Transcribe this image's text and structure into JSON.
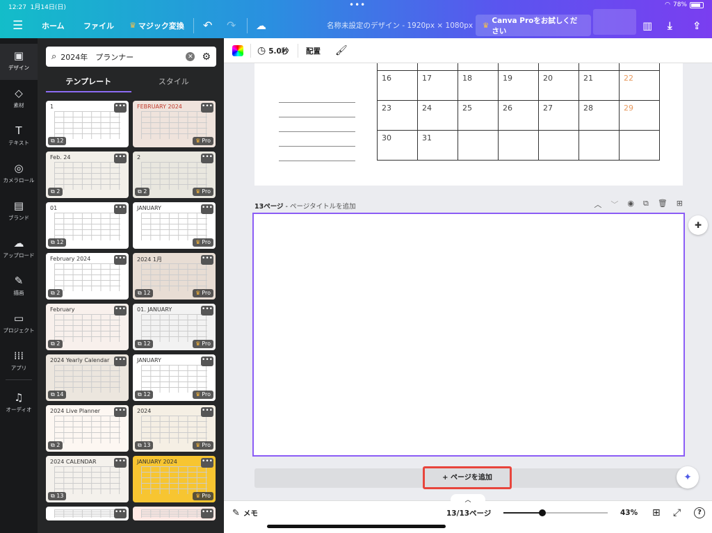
{
  "status": {
    "time": "12:27",
    "date": "1月14日(日)",
    "battery": "78%",
    "dots": "•••"
  },
  "topbar": {
    "menu_icon": "hamburger-icon",
    "home": "ホーム",
    "file": "ファイル",
    "magic": "マジック変換",
    "doc_title": "名称未設定のデザイン - 1920px × 1080px",
    "pro_button": "Canva Proをお試しください",
    "accent": "#7a3ef0"
  },
  "rail": [
    {
      "label": "デザイン",
      "icon": "design-icon",
      "glyph": "▣"
    },
    {
      "label": "素材",
      "icon": "elements-icon",
      "glyph": "◇"
    },
    {
      "label": "テキスト",
      "icon": "text-icon",
      "glyph": "T"
    },
    {
      "label": "カメラロール",
      "icon": "camera-icon",
      "glyph": "◎"
    },
    {
      "label": "ブランド",
      "icon": "brand-icon",
      "glyph": "▤"
    },
    {
      "label": "アップロード",
      "icon": "upload-icon",
      "glyph": "☁"
    },
    {
      "label": "描画",
      "icon": "draw-icon",
      "glyph": "✎"
    },
    {
      "label": "プロジェクト",
      "icon": "folder-icon",
      "glyph": "▭"
    },
    {
      "label": "アプリ",
      "icon": "apps-icon",
      "glyph": "⁞⁞⁞"
    },
    {
      "label": "オーディオ",
      "icon": "audio-icon",
      "glyph": "♫"
    }
  ],
  "panel": {
    "search_value": "2024年　プランナー",
    "tabs": [
      "テンプレート",
      "スタイル"
    ],
    "templates": [
      {
        "count": "12",
        "pro": false,
        "text": "1"
      },
      {
        "count": "",
        "pro": true,
        "text": "FEBRUARY 2024"
      },
      {
        "count": "2",
        "pro": false,
        "text": "Feb. 24"
      },
      {
        "count": "2",
        "pro": true,
        "text": "2"
      },
      {
        "count": "12",
        "pro": false,
        "text": "01"
      },
      {
        "count": "",
        "pro": true,
        "text": "JANUARY"
      },
      {
        "count": "2",
        "pro": false,
        "text": "February 2024"
      },
      {
        "count": "12",
        "pro": true,
        "text": "2024 1月"
      },
      {
        "count": "2",
        "pro": false,
        "text": "February"
      },
      {
        "count": "12",
        "pro": true,
        "text": "01. JANUARY"
      },
      {
        "count": "14",
        "pro": false,
        "text": "2024 Yearly Calendar"
      },
      {
        "count": "12",
        "pro": true,
        "text": "JANUARY"
      },
      {
        "count": "2",
        "pro": false,
        "text": "2024 Live Planner"
      },
      {
        "count": "13",
        "pro": true,
        "text": "2024"
      },
      {
        "count": "13",
        "pro": false,
        "text": "2024 CALENDAR"
      },
      {
        "count": "",
        "pro": true,
        "text": "JANUARY 2024"
      },
      {
        "count": "",
        "pro": false,
        "text": ""
      },
      {
        "count": "",
        "pro": false,
        "text": ""
      }
    ],
    "pro_label": "Pro",
    "more_label": "•••"
  },
  "canvas_toolbar": {
    "duration": "5.0秒",
    "position": "配置"
  },
  "calendar": {
    "rows": [
      [
        "16",
        "17",
        "18",
        "19",
        "20",
        "21",
        "22"
      ],
      [
        "23",
        "24",
        "25",
        "26",
        "27",
        "28",
        "29"
      ],
      [
        "30",
        "31",
        "",
        "",
        "",
        "",
        ""
      ]
    ],
    "sunday_color": "#e89a5f"
  },
  "page": {
    "number": "13ページ",
    "title_placeholder": "ページタイトルを追加",
    "add_page": "+ ページを追加",
    "selection_color": "#8b5cf6"
  },
  "bottom": {
    "memo": "メモ",
    "page_indicator": "13/13ページ",
    "zoom": "43%",
    "zoom_fraction": 0.37
  }
}
